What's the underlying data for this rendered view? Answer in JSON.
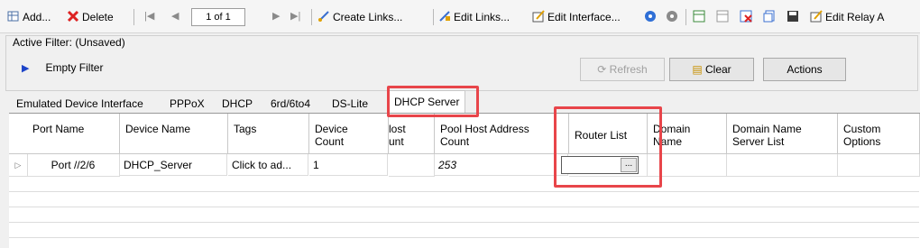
{
  "toolbar": {
    "add": "Add...",
    "delete": "Delete",
    "page": "1 of 1",
    "create_links": "Create Links...",
    "edit_links": "Edit Links...",
    "edit_interface": "Edit Interface...",
    "edit_relay": "Edit Relay A"
  },
  "filter": {
    "title": "Active Filter: (Unsaved)",
    "empty": "Empty Filter",
    "refresh": "Refresh",
    "clear": "Clear",
    "actions": "Actions"
  },
  "tabs": [
    "Emulated Device Interface",
    "PPPoX",
    "DHCP",
    "6rd/6to4",
    "DS-Lite",
    "DHCP Server"
  ],
  "grid": {
    "headers": {
      "port_name": "Port Name",
      "device_name": "Device Name",
      "tags": "Tags",
      "device_count": "Device Count",
      "host_count": "lost unt",
      "pool_host": "Pool Host Address Count",
      "router_list": "Router List",
      "domain_name": "Domain Name",
      "domain_server": "Domain Name Server List",
      "custom_options": "Custom Options"
    },
    "row": {
      "port": "Port //2/6",
      "device": "DHCP_Server",
      "tags": "Click to ad...",
      "count": "1",
      "pool": "253",
      "ellipsis": "..."
    }
  },
  "colors": {
    "highlight": "#e8454a",
    "accent": "#1d44c8"
  }
}
